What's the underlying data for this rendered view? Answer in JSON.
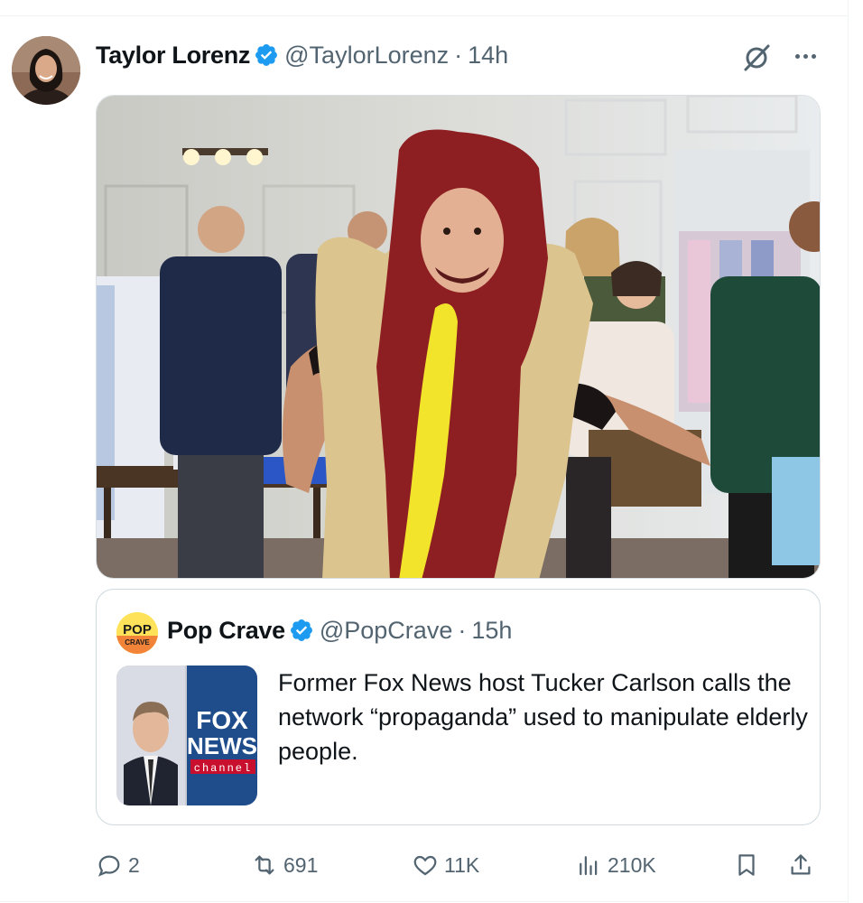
{
  "tweet": {
    "author_name": "Taylor Lorenz",
    "author_handle": "@TaylorLorenz",
    "separator": "·",
    "time": "14h",
    "verified": true
  },
  "quoted_tweet": {
    "author_name": "Pop Crave",
    "author_handle": "@PopCrave",
    "separator": "·",
    "time": "15h",
    "verified": true,
    "avatar_text_top": "POP",
    "avatar_text_bottom": "CRAVE",
    "thumb_logo_line1": "FOX",
    "thumb_logo_line2": "NEWS",
    "thumb_logo_line3": "channel",
    "text": "Former Fox News host Tucker Carlson calls the network “propaganda” used to manipulate elderly people."
  },
  "actions": {
    "replies": "2",
    "retweets": "691",
    "likes": "11K",
    "views": "210K"
  },
  "icons": {
    "verified": "verified-badge-icon",
    "grok": "grok-icon",
    "more": "more-icon",
    "reply": "reply-icon",
    "retweet": "retweet-icon",
    "like": "heart-icon",
    "views": "views-icon",
    "bookmark": "bookmark-icon",
    "share": "share-icon"
  },
  "colors": {
    "verified": "#1d9bf0",
    "muted_text": "#536471",
    "primary_text": "#0f1419",
    "border": "#cfd9de"
  }
}
